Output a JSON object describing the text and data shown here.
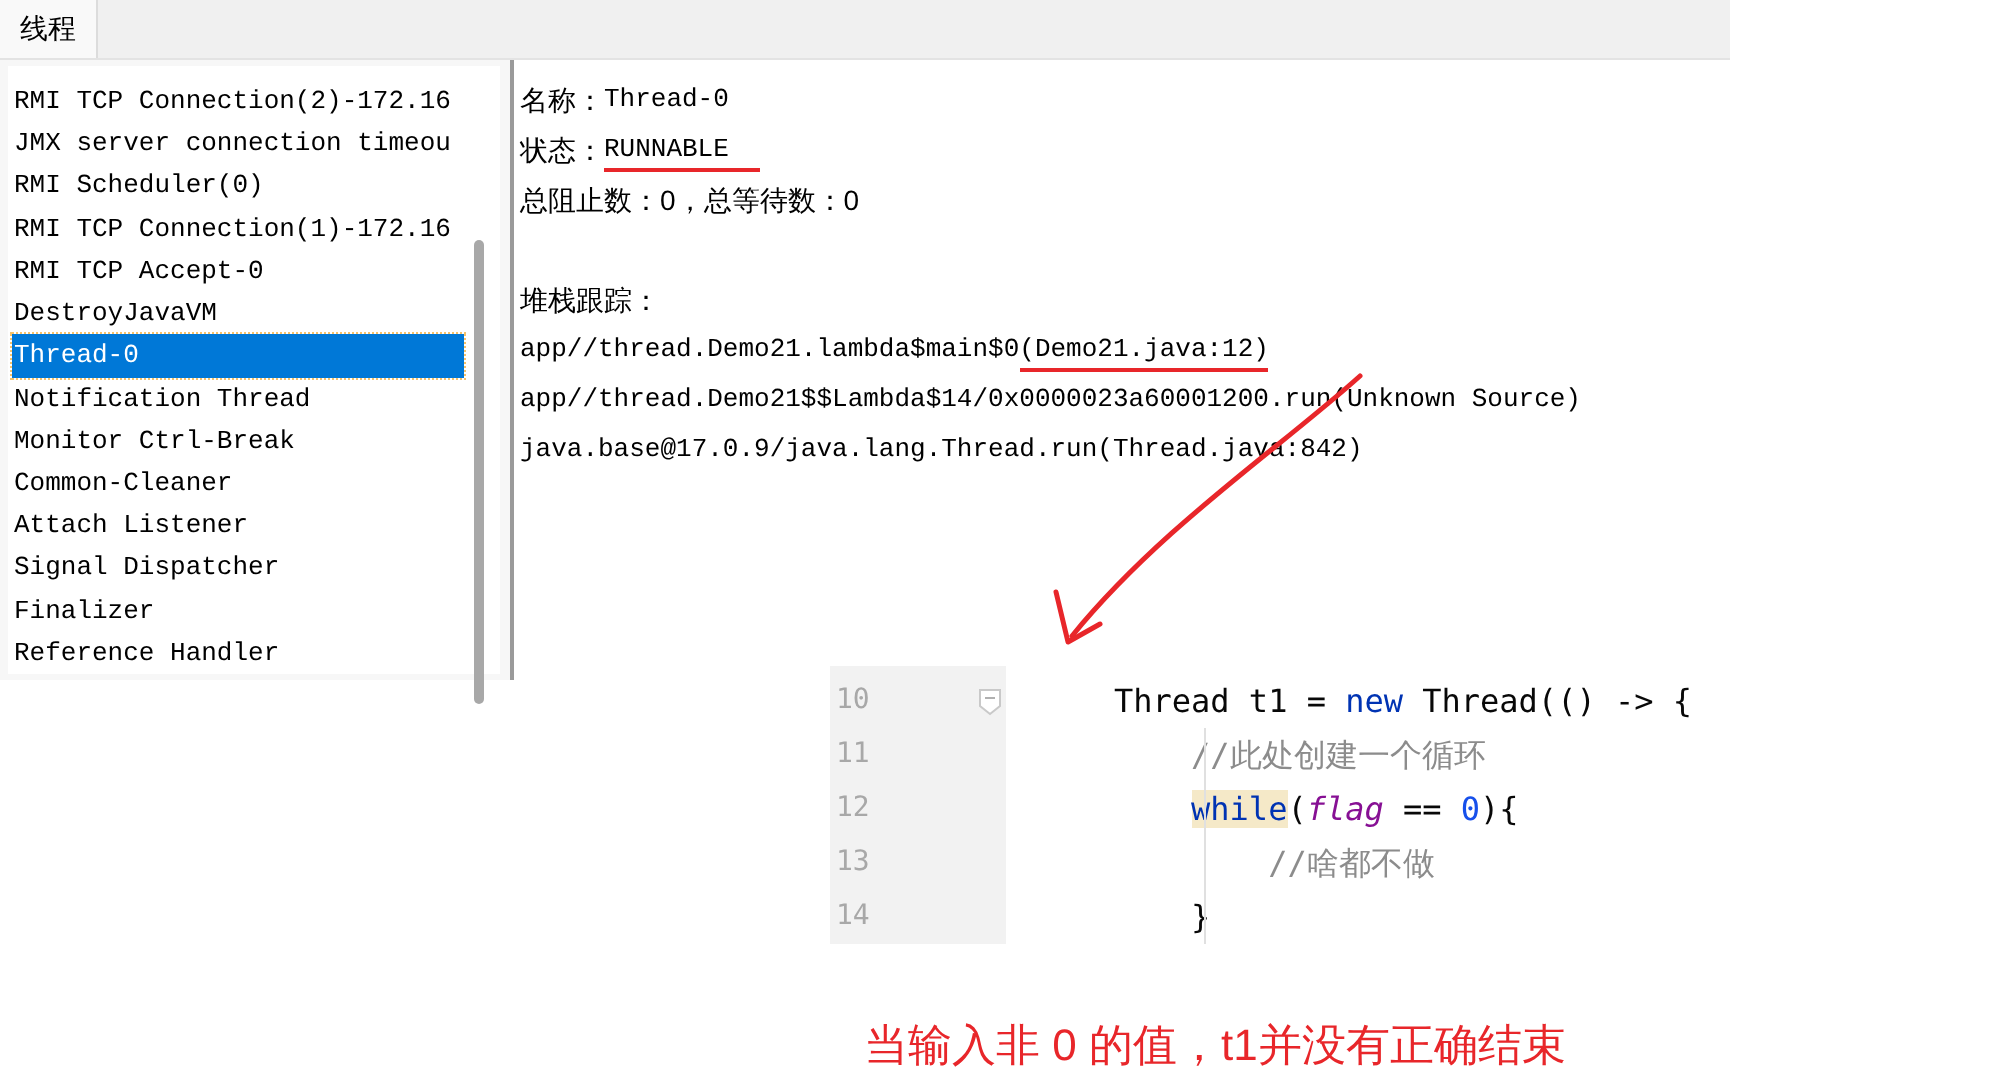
{
  "tabs": [
    {
      "label": "线程",
      "selected": true
    }
  ],
  "threads": [
    {
      "name": "RMI TCP Connection(2)-172.16",
      "selected": false
    },
    {
      "name": "JMX server connection timeou",
      "selected": false
    },
    {
      "name": "RMI Scheduler(0)",
      "selected": false
    },
    {
      "name": "RMI TCP Connection(1)-172.16",
      "selected": false
    },
    {
      "name": "RMI TCP Accept-0",
      "selected": false
    },
    {
      "name": "DestroyJavaVM",
      "selected": false
    },
    {
      "name": "Thread-0",
      "selected": true
    },
    {
      "name": "Notification Thread",
      "selected": false
    },
    {
      "name": "Monitor Ctrl-Break",
      "selected": false
    },
    {
      "name": "Common-Cleaner",
      "selected": false
    },
    {
      "name": "Attach Listener",
      "selected": false
    },
    {
      "name": "Signal Dispatcher",
      "selected": false
    },
    {
      "name": "Finalizer",
      "selected": false
    },
    {
      "name": "Reference Handler",
      "selected": false
    }
  ],
  "details": {
    "fields": [
      {
        "label": "名称：",
        "value": "Thread-0",
        "underlined": false
      },
      {
        "label": "状态：",
        "value": "RUNNABLE",
        "underlined": true
      }
    ],
    "counts": "总阻止数：0，总等待数：0",
    "stack_title": "堆栈跟踪：",
    "stack_trace": [
      {
        "parts": [
          {
            "text": "app//thread.Demo21.lambda$main$0",
            "underlined": false
          },
          {
            "text": "(Demo21.java:12)",
            "underlined": true
          }
        ]
      },
      {
        "parts": [
          {
            "text": "app//thread.Demo21$$Lambda$14/0x0000023a60001200.run(Unknown Source)",
            "underlined": false
          }
        ]
      },
      {
        "parts": [
          {
            "text": "java.base@17.0.9/java.lang.Thread.run(Thread.java:842)",
            "underlined": false
          }
        ]
      }
    ]
  },
  "code": {
    "lines": [
      {
        "number": "10",
        "fold": true,
        "tokens": [
          {
            "kind": "plain",
            "text": "Thread t1 = "
          },
          {
            "kind": "keyword",
            "text": "new"
          },
          {
            "kind": "plain",
            "text": " Thread(() -> {"
          }
        ]
      },
      {
        "number": "11",
        "fold": false,
        "tokens": [
          {
            "kind": "comment",
            "text": "    //此处创建一个循环"
          }
        ]
      },
      {
        "number": "12",
        "fold": false,
        "tokens": [
          {
            "kind": "highlight",
            "text": "    while"
          },
          {
            "kind": "plain",
            "text": "("
          },
          {
            "kind": "field",
            "text": "flag"
          },
          {
            "kind": "plain",
            "text": " == "
          },
          {
            "kind": "number",
            "text": "0"
          },
          {
            "kind": "plain",
            "text": "){"
          }
        ]
      },
      {
        "number": "13",
        "fold": false,
        "tokens": [
          {
            "kind": "comment",
            "text": "        //啥都不做"
          }
        ]
      },
      {
        "number": "14",
        "fold": false,
        "tokens": [
          {
            "kind": "plain",
            "text": "    }"
          }
        ]
      }
    ]
  },
  "caption": "当输入非 0 的值，t1并没有正确结束"
}
